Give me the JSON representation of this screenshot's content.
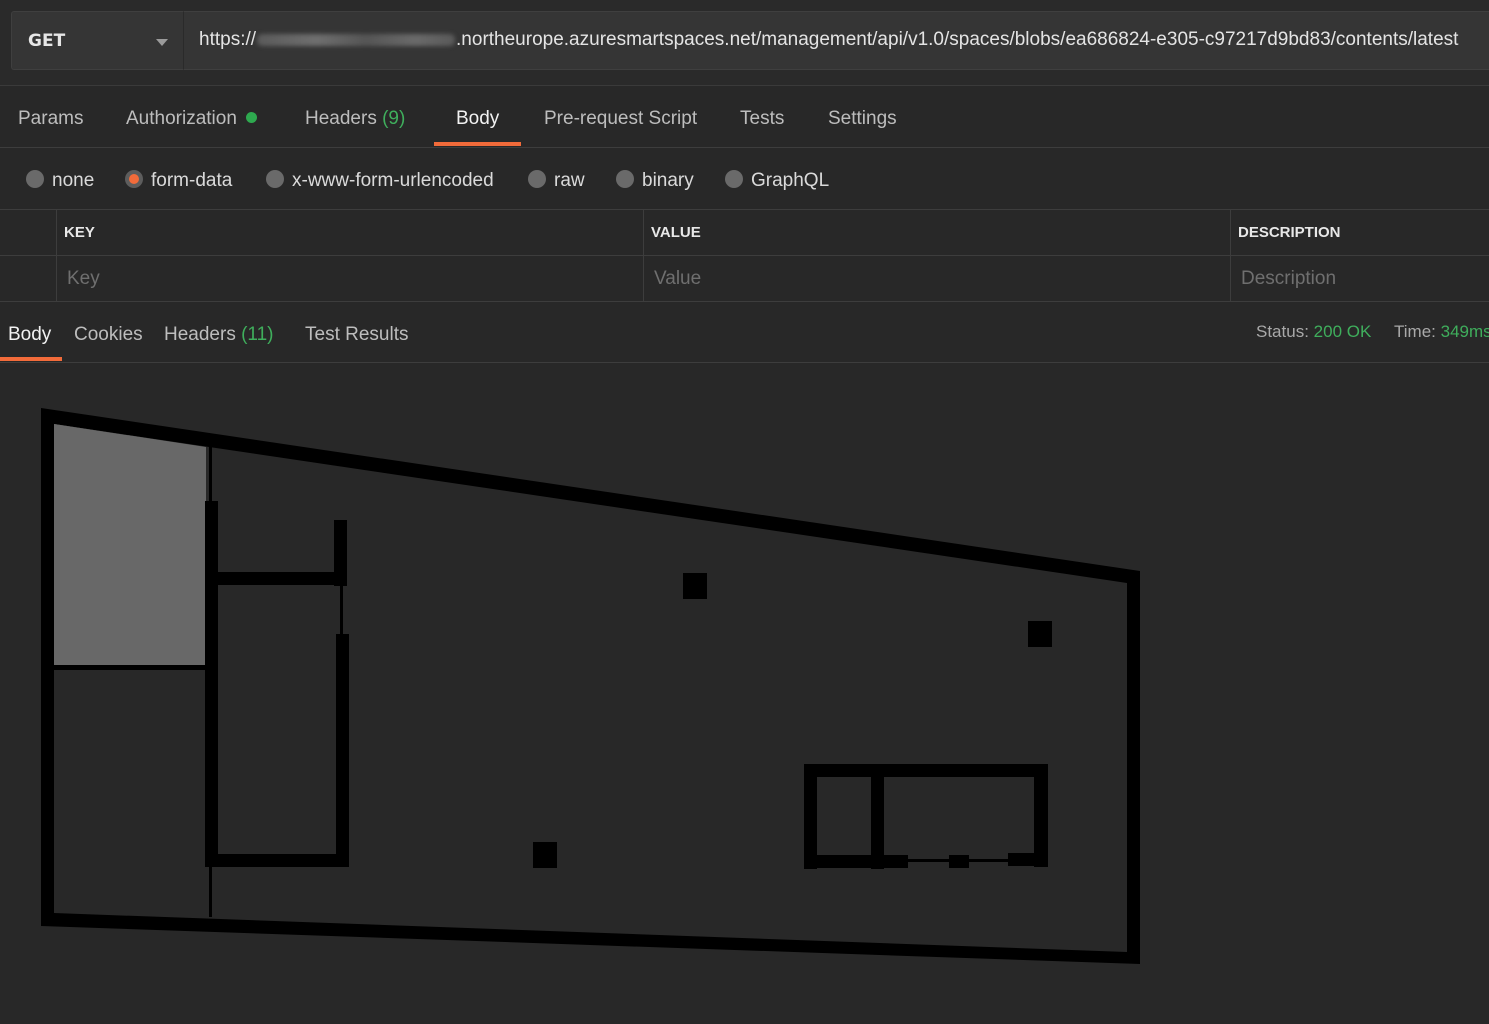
{
  "request": {
    "method": "GET",
    "url_prefix": "https://",
    "url_suffix": ".northeurope.azuresmartspaces.net/management/api/v1.0/spaces/blobs/ea686824-e305-c97217d9bd83/contents/latest"
  },
  "request_tabs": [
    {
      "label": "Params"
    },
    {
      "label": "Authorization"
    },
    {
      "label": "Headers",
      "count": "(9)"
    },
    {
      "label": "Body"
    },
    {
      "label": "Pre-request Script"
    },
    {
      "label": "Tests"
    },
    {
      "label": "Settings"
    }
  ],
  "active_request_tab": "Body",
  "body_types": [
    {
      "label": "none"
    },
    {
      "label": "form-data"
    },
    {
      "label": "x-www-form-urlencoded"
    },
    {
      "label": "raw"
    },
    {
      "label": "binary"
    },
    {
      "label": "GraphQL"
    }
  ],
  "selected_body_type": "form-data",
  "kv_table": {
    "headers": {
      "key": "KEY",
      "value": "VALUE",
      "description": "DESCRIPTION"
    },
    "placeholders": {
      "key": "Key",
      "value": "Value",
      "description": "Description"
    }
  },
  "response_tabs": [
    {
      "label": "Body"
    },
    {
      "label": "Cookies"
    },
    {
      "label": "Headers",
      "count": "(11)"
    },
    {
      "label": "Test Results"
    }
  ],
  "active_response_tab": "Body",
  "response_meta": {
    "status_label": "Status:",
    "status_value": "200 OK",
    "time_label": "Time:",
    "time_value": "349ms"
  },
  "colors": {
    "accent": "#f26b3a",
    "success": "#3fae5c",
    "auth_dot": "#2ea94f"
  }
}
